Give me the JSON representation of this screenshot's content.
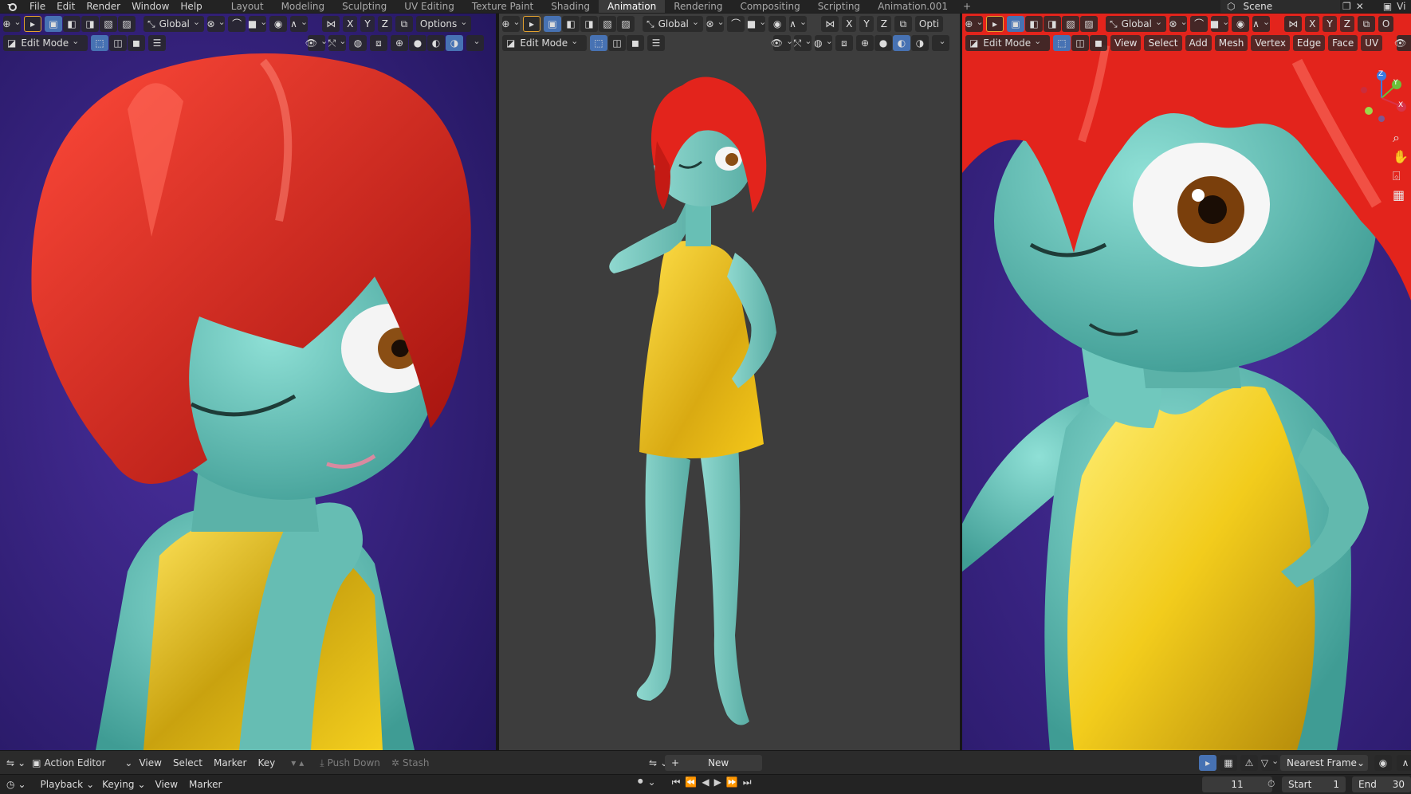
{
  "menu": {
    "file": "File",
    "edit": "Edit",
    "render": "Render",
    "window": "Window",
    "help": "Help"
  },
  "workspaces": [
    "Layout",
    "Modeling",
    "Sculpting",
    "UV Editing",
    "Texture Paint",
    "Shading",
    "Animation",
    "Rendering",
    "Compositing",
    "Scripting",
    "Animation.001"
  ],
  "active_workspace": "Animation",
  "add_workspace": "+",
  "scene": "Scene",
  "view_layer_partial": "Vi",
  "viewports": {
    "left": {
      "transform": "Global",
      "options": "Options",
      "mode": "Edit Mode",
      "axes": [
        "X",
        "Y",
        "Z"
      ]
    },
    "middle": {
      "transform": "Global",
      "options_partial": "Opti",
      "mode": "Edit Mode",
      "axes": [
        "X",
        "Y",
        "Z"
      ]
    },
    "right": {
      "transform": "Global",
      "options_partial": "O",
      "mode": "Edit Mode",
      "axes": [
        "X",
        "Y",
        "Z"
      ],
      "menus": [
        "View",
        "Select",
        "Add",
        "Mesh",
        "Vertex",
        "Edge",
        "Face",
        "UV"
      ],
      "gizmo": {
        "z": "Z",
        "y": "Y",
        "x": "X"
      }
    }
  },
  "action_editor": {
    "editor_type": "Action Editor",
    "menus": [
      "View",
      "Select",
      "Marker",
      "Key"
    ],
    "push_down": "Push Down",
    "stash": "Stash",
    "new": "New",
    "snap": "Nearest Frame"
  },
  "timeline": {
    "menus": [
      "Playback",
      "Keying",
      "View",
      "Marker"
    ],
    "current_frame": "11",
    "start_label": "Start",
    "start": "1",
    "end_label": "End",
    "end": "30"
  },
  "colors": {
    "accent": "#4772b3",
    "bg": "#1d1d1d",
    "header": "#2b2b2b",
    "hair": "#e8201c",
    "skin": "#6fc7bc",
    "dress": "#f0c419",
    "left_bg": "#3a2a86",
    "mid_bg": "#3d3d3d"
  }
}
